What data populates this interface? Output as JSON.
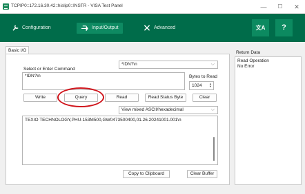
{
  "window": {
    "title": "TCPIP0::172.16.30.42::hislip0::INSTR - VISA Test Panel",
    "minimize": "—",
    "maximize": "☐",
    "close": "✕"
  },
  "toolbar": {
    "configuration_label": "Configuration",
    "input_output_label": "Input/Output",
    "advanced_label": "Advanced",
    "language_label": "文A",
    "help_label": "?"
  },
  "basic_io": {
    "tab_label": "Basic I/O",
    "command_label": "Select or Enter Command",
    "command_dropdown_value": "*IDN?\\n",
    "command_value": "*IDN?\\n",
    "bytes_to_read_label": "Bytes to Read",
    "bytes_to_read_value": "1024",
    "buttons": {
      "write": "Write",
      "query": "Query",
      "read": "Read",
      "read_status_byte": "Read Status Byte",
      "clear": "Clear",
      "copy_to_clipboard": "Copy to Clipboard",
      "clear_buffer": "Clear Buffer"
    },
    "view_mode_value": "View mixed ASCII/hexadecimal",
    "response_text": "TEXIO TECHNOLOGY,PHU-153M500,GW0473500400,01.26.20241001.001\\n"
  },
  "return_data": {
    "label": "Return Data",
    "lines": [
      "Read Operation",
      "No Error"
    ]
  },
  "colors": {
    "toolbar_bg": "#006c4a",
    "highlight_ring": "#d0151c"
  }
}
